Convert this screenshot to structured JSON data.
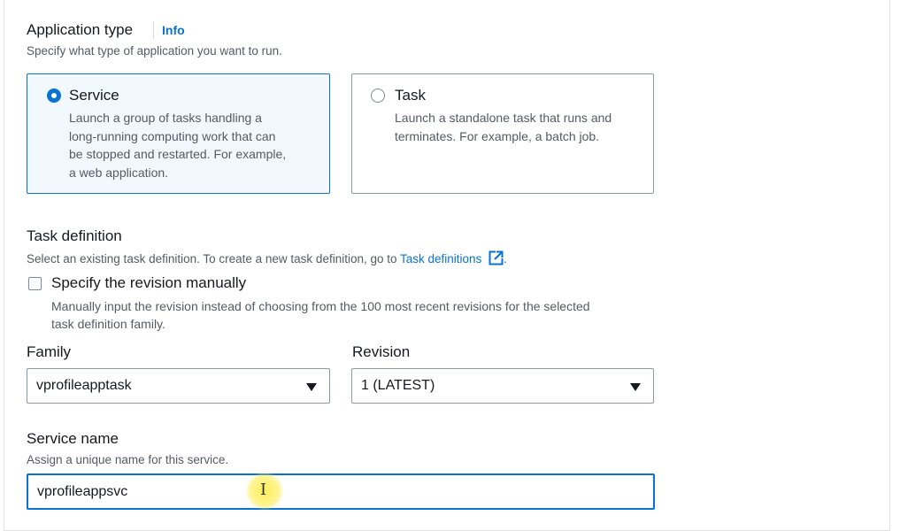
{
  "application_type": {
    "label": "Application type",
    "info": "Info",
    "description": "Specify what type of application you want to run.",
    "options": [
      {
        "title": "Service",
        "lines": [
          "Launch a group of tasks handling a",
          "long-running computing work that can",
          "be stopped and restarted. For example,",
          "a web application."
        ],
        "selected": true
      },
      {
        "title": "Task",
        "lines": [
          "Launch a standalone task that runs and",
          "terminates. For example, a batch job."
        ],
        "selected": false
      }
    ]
  },
  "task_definition": {
    "label": "Task definition",
    "description_prefix": "Select an existing task definition. To create a new task definition, go to ",
    "link": "Task definitions",
    "description_suffix": ".",
    "revision_checkbox": {
      "label": "Specify the revision manually",
      "checked": false,
      "lines": [
        "Manually input the revision instead of choosing from the 100 most recent revisions for the selected",
        "task definition family."
      ]
    },
    "family": {
      "label": "Family",
      "value": "vprofileapptask"
    },
    "revision": {
      "label": "Revision",
      "value": "1 (LATEST)"
    }
  },
  "service_name": {
    "label": "Service name",
    "description": "Assign a unique name for this service.",
    "value": "vprofileappsvc"
  },
  "colors": {
    "accent": "#0972d3",
    "cursor_highlight": "#ffec3c"
  }
}
